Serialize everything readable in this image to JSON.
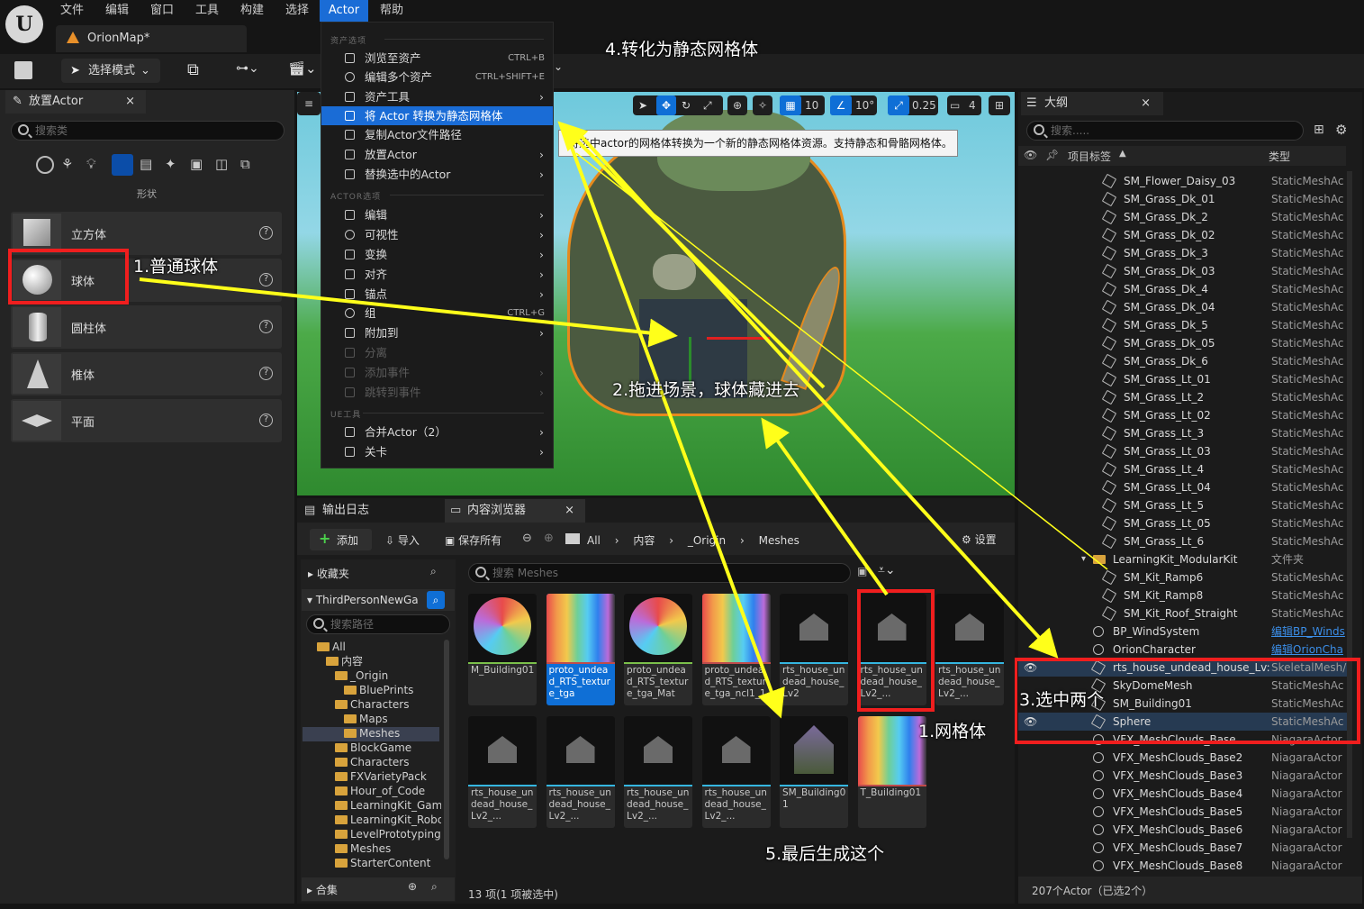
{
  "menubar": {
    "logo": "U",
    "items": [
      "文件",
      "编辑",
      "窗口",
      "工具",
      "构建",
      "选择",
      "Actor",
      "帮助"
    ]
  },
  "document_tab": "OrionMap*",
  "toolbar": {
    "select_mode": "选择模式"
  },
  "place_actor": {
    "title": "放置Actor",
    "close": "×",
    "search_placeholder": "搜索类",
    "category": "形状",
    "shapes": [
      "立方体",
      "球体",
      "圆柱体",
      "椎体",
      "平面"
    ]
  },
  "context_menu": {
    "section_asset": "资产选项",
    "browse": "浏览至资产",
    "browse_sc": "CTRL+B",
    "edit_multi": "编辑多个资产",
    "edit_multi_sc": "CTRL+SHIFT+E",
    "asset_tools": "资产工具",
    "convert": "将 Actor 转换为静态网格体",
    "copy_path": "复制Actor文件路径",
    "place_actor": "放置Actor",
    "replace": "替换选中的Actor",
    "section_actor": "ACTOR选项",
    "edit": "编辑",
    "visibility": "可视性",
    "transform": "变换",
    "align": "对齐",
    "pivot": "锚点",
    "group": "组",
    "group_sc": "CTRL+G",
    "attach": "附加到",
    "detach": "分离",
    "add_event": "添加事件",
    "jump_event": "跳转到事件",
    "section_ue": "UE工具",
    "merge": "合并Actor（2）",
    "level": "关卡"
  },
  "tooltip": "将选中actor的网格体转换为一个新的静态网格体资源。支持静态和骨骼网格体。",
  "viewport_tools": {
    "grid": "10",
    "angle": "10°",
    "scale": "0.25",
    "camera": "4"
  },
  "outliner": {
    "title": "大纲",
    "close": "×",
    "search_placeholder": "搜索.....",
    "col_label": "项目标签",
    "col_type": "类型",
    "rows": [
      {
        "name": "SM_Flower_Daisy_03",
        "type": "StaticMeshAc"
      },
      {
        "name": "SM_Grass_Dk_01",
        "type": "StaticMeshAc"
      },
      {
        "name": "SM_Grass_Dk_2",
        "type": "StaticMeshAc"
      },
      {
        "name": "SM_Grass_Dk_02",
        "type": "StaticMeshAc"
      },
      {
        "name": "SM_Grass_Dk_3",
        "type": "StaticMeshAc"
      },
      {
        "name": "SM_Grass_Dk_03",
        "type": "StaticMeshAc"
      },
      {
        "name": "SM_Grass_Dk_4",
        "type": "StaticMeshAc"
      },
      {
        "name": "SM_Grass_Dk_04",
        "type": "StaticMeshAc"
      },
      {
        "name": "SM_Grass_Dk_5",
        "type": "StaticMeshAc"
      },
      {
        "name": "SM_Grass_Dk_05",
        "type": "StaticMeshAc"
      },
      {
        "name": "SM_Grass_Dk_6",
        "type": "StaticMeshAc"
      },
      {
        "name": "SM_Grass_Lt_01",
        "type": "StaticMeshAc"
      },
      {
        "name": "SM_Grass_Lt_2",
        "type": "StaticMeshAc"
      },
      {
        "name": "SM_Grass_Lt_02",
        "type": "StaticMeshAc"
      },
      {
        "name": "SM_Grass_Lt_3",
        "type": "StaticMeshAc"
      },
      {
        "name": "SM_Grass_Lt_03",
        "type": "StaticMeshAc"
      },
      {
        "name": "SM_Grass_Lt_4",
        "type": "StaticMeshAc"
      },
      {
        "name": "SM_Grass_Lt_04",
        "type": "StaticMeshAc"
      },
      {
        "name": "SM_Grass_Lt_5",
        "type": "StaticMeshAc"
      },
      {
        "name": "SM_Grass_Lt_05",
        "type": "StaticMeshAc"
      },
      {
        "name": "SM_Grass_Lt_6",
        "type": "StaticMeshAc"
      },
      {
        "name": "LearningKit_ModularKit",
        "type": "文件夹"
      },
      {
        "name": "SM_Kit_Ramp6",
        "type": "StaticMeshAc"
      },
      {
        "name": "SM_Kit_Ramp8",
        "type": "StaticMeshAc"
      },
      {
        "name": "SM_Kit_Roof_Straight",
        "type": "StaticMeshAc"
      },
      {
        "name": "BP_WindSystem",
        "type": "编辑BP_Winds"
      },
      {
        "name": "OrionCharacter",
        "type": "编辑OrionCha"
      },
      {
        "name": "rts_house_undead_house_Lv:",
        "type": "SkeletalMesh/"
      },
      {
        "name": "SkyDomeMesh",
        "type": "StaticMeshAc"
      },
      {
        "name": "SM_Building01",
        "type": "StaticMeshAc"
      },
      {
        "name": "Sphere",
        "type": "StaticMeshAc"
      },
      {
        "name": "VFX_MeshClouds_Base",
        "type": "NiagaraActor"
      },
      {
        "name": "VFX_MeshClouds_Base2",
        "type": "NiagaraActor"
      },
      {
        "name": "VFX_MeshClouds_Base3",
        "type": "NiagaraActor"
      },
      {
        "name": "VFX_MeshClouds_Base4",
        "type": "NiagaraActor"
      },
      {
        "name": "VFX_MeshClouds_Base5",
        "type": "NiagaraActor"
      },
      {
        "name": "VFX_MeshClouds_Base6",
        "type": "NiagaraActor"
      },
      {
        "name": "VFX_MeshClouds_Base7",
        "type": "NiagaraActor"
      },
      {
        "name": "VFX_MeshClouds_Base8",
        "type": "NiagaraActor"
      }
    ],
    "status": "207个Actor（已选2个）"
  },
  "content_browser": {
    "tab_log": "输出日志",
    "tab_cb": "内容浏览器",
    "close": "×",
    "add": "添加",
    "import": "导入",
    "save_all": "保存所有",
    "path": [
      "All",
      "内容",
      "_Origin",
      "Meshes"
    ],
    "settings": "设置",
    "favorites": "收藏夹",
    "project": "ThirdPersonNewGa",
    "search_path": "搜索路径",
    "search_meshes": "搜索 Meshes",
    "folders": [
      "All",
      "内容",
      "_Origin",
      "BluePrints",
      "Characters",
      "Maps",
      "Meshes",
      "BlockGame",
      "Characters",
      "FXVarietyPack",
      "Hour_of_Code",
      "LearningKit_Gam",
      "LearningKit_Robc",
      "LevelPrototyping",
      "Meshes",
      "StarterContent"
    ],
    "collections": "合集",
    "assets": [
      "M_Building01",
      "proto_undead_RTS_texture_tga",
      "proto_undead_RTS_texture_tga_Mat",
      "proto_undead_RTS_texture_tga_ncl1_1",
      "rts_house_undead_house_Lv2",
      "rts_house_undead_house_Lv2_...",
      "rts_house_undead_house_Lv2_...",
      "rts_house_undead_house_Lv2_...",
      "rts_house_undead_house_Lv2_...",
      "rts_house_undead_house_Lv2_...",
      "rts_house_undead_house_Lv2_...",
      "SM_Building01",
      "T_Building01"
    ],
    "status": "13 项(1 项被选中)"
  },
  "annotations": {
    "a1": "1.普通球体",
    "a2": "2.拖进场景，球体藏进去",
    "a3": "3.选中两个",
    "a4": "4.转化为静态网格体",
    "a5": "5.最后生成这个",
    "a6": "1.网格体"
  },
  "colors": {
    "accent": "#1a6cd6",
    "annotation_red": "#f01e1e",
    "arrow_yellow": "#ffff1a",
    "selection_blue": "#0f6fd6"
  }
}
